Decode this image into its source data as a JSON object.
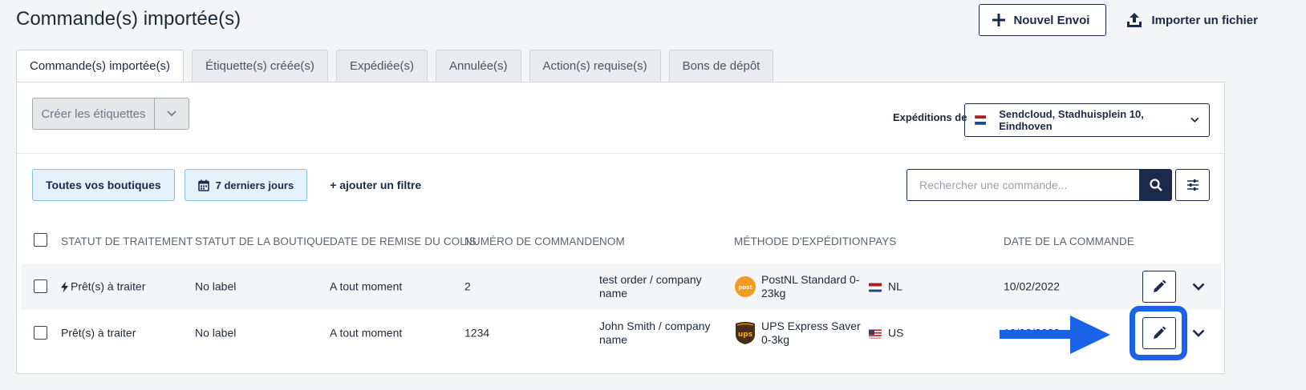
{
  "header": {
    "title": "Commande(s) importée(s)",
    "new_shipment_label": "Nouvel Envoi",
    "import_label": "Importer un fichier"
  },
  "tabs": [
    {
      "label": "Commande(s) importée(s)",
      "active": true
    },
    {
      "label": "Étiquette(s) créée(s)",
      "active": false
    },
    {
      "label": "Expédiée(s)",
      "active": false
    },
    {
      "label": "Annulée(s)",
      "active": false
    },
    {
      "label": "Action(s) requise(s)",
      "active": false
    },
    {
      "label": "Bons de dépôt",
      "active": false
    }
  ],
  "toolbar": {
    "create_labels": "Créer les étiquettes",
    "shipments_from_label": "Expéditions de",
    "shipments_from_value": "Sendcloud, Stadhuisplein 10, Eindhoven"
  },
  "filters": {
    "shops": "Toutes vos boutiques",
    "date_range": "7 derniers jours",
    "add_filter": "+ ajouter un filtre",
    "search_placeholder": "Rechercher une commande..."
  },
  "table": {
    "columns": [
      "STATUT DE TRAITEMENT",
      "STATUT DE LA BOUTIQUE",
      "DATE DE REMISE DU COLIS",
      "NUMÉRO DE COMMANDE",
      "NOM",
      "MÉTHODE D'EXPÉDITION",
      "PAYS",
      "DATE DE LA COMMANDE"
    ],
    "rows": [
      {
        "status": "Prêt(s) à traiter",
        "shop_status": "No label",
        "handover": "A tout moment",
        "order_number": "2",
        "name_line1": "test order / company",
        "name_line2": "name",
        "carrier_logo": "postnl",
        "method_line1": "PostNL Standard 0-",
        "method_line2": "23kg",
        "country": "NL",
        "order_date": "10/02/2022"
      },
      {
        "status": "Prêt(s) à traiter",
        "shop_status": "No label",
        "handover": "A tout moment",
        "order_number": "1234",
        "name_line1": "John Smith / company",
        "name_line2": "name",
        "carrier_logo": "ups",
        "method_line1": "UPS Express Saver",
        "method_line2": "0-3kg",
        "country": "US",
        "order_date": "10/02/2022"
      }
    ]
  },
  "colors": {
    "navy": "#1b2a48",
    "highlight_blue": "#1a63e8",
    "chip_bg": "#e3f2fb"
  },
  "icons": [
    "plus-icon",
    "upload-icon",
    "chevron-down-icon",
    "calendar-icon",
    "search-icon",
    "sliders-icon",
    "lightning-icon",
    "pencil-icon",
    "netherlands-flag-icon",
    "usa-flag-icon"
  ]
}
